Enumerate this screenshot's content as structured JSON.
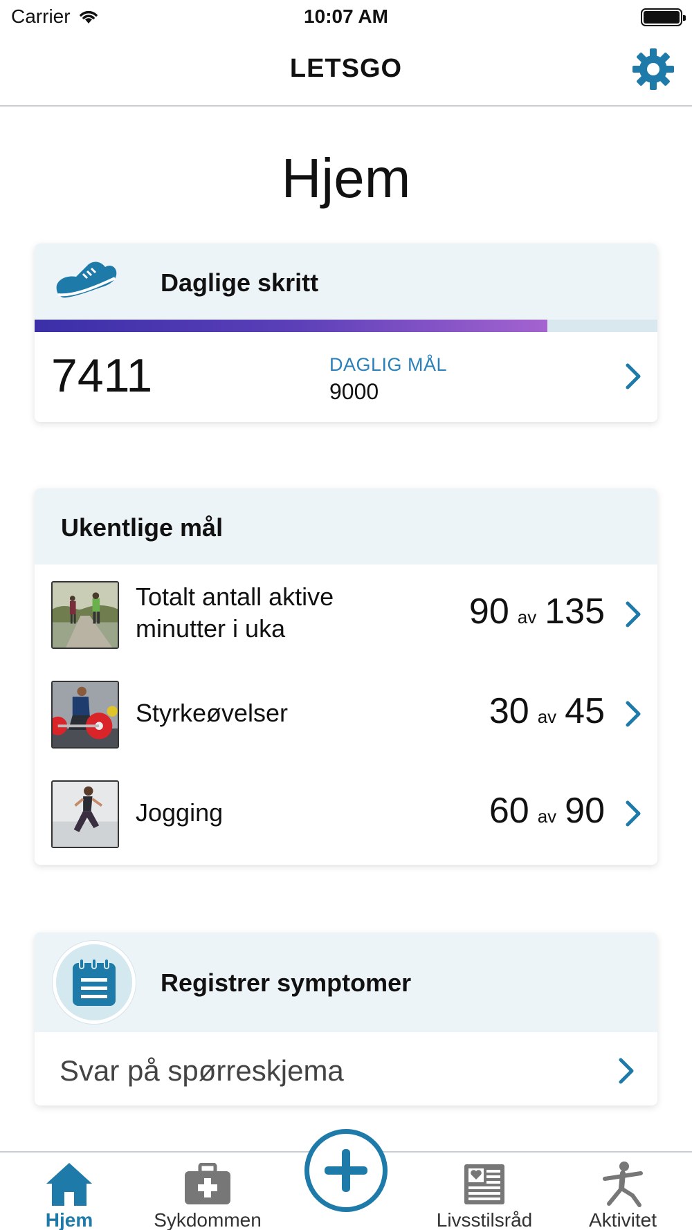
{
  "status_bar": {
    "carrier": "Carrier",
    "time": "10:07 AM"
  },
  "nav": {
    "title": "LETSGO",
    "settings_icon": "gear-icon"
  },
  "page": {
    "title": "Hjem"
  },
  "steps": {
    "title": "Daglige skritt",
    "count": "7411",
    "goal_label": "DAGLIG MÅL",
    "goal_value": "9000",
    "progress": 0.823
  },
  "weekly": {
    "title": "Ukentlige mål",
    "goals": [
      {
        "name_line1": "Totalt antall aktive",
        "name_line2": "minutter i uka",
        "done": "90",
        "av": "av",
        "total": "135",
        "image": "walking-couple"
      },
      {
        "name_line1": "Styrkeøvelser",
        "name_line2": "",
        "done": "30",
        "av": "av",
        "total": "45",
        "image": "weightlifting"
      },
      {
        "name_line1": "Jogging",
        "name_line2": "",
        "done": "60",
        "av": "av",
        "total": "90",
        "image": "jogging"
      }
    ]
  },
  "symptoms": {
    "title": "Registrer symptomer",
    "link": "Svar på spørreskjema"
  },
  "tabs": [
    {
      "label": "Hjem",
      "icon": "home-icon",
      "active": true
    },
    {
      "label": "Sykdommen",
      "icon": "medkit-icon",
      "active": false
    },
    {
      "label": "",
      "icon": "plus-icon",
      "active": false
    },
    {
      "label": "Livsstilsråd",
      "icon": "news-icon",
      "active": false
    },
    {
      "label": "Aktivitet",
      "icon": "activity-icon",
      "active": false
    }
  ],
  "colors": {
    "accent": "#1e7aa8",
    "card_head": "#edf4f8",
    "progress_start": "#3b2fa8",
    "progress_end": "#a463d0"
  }
}
